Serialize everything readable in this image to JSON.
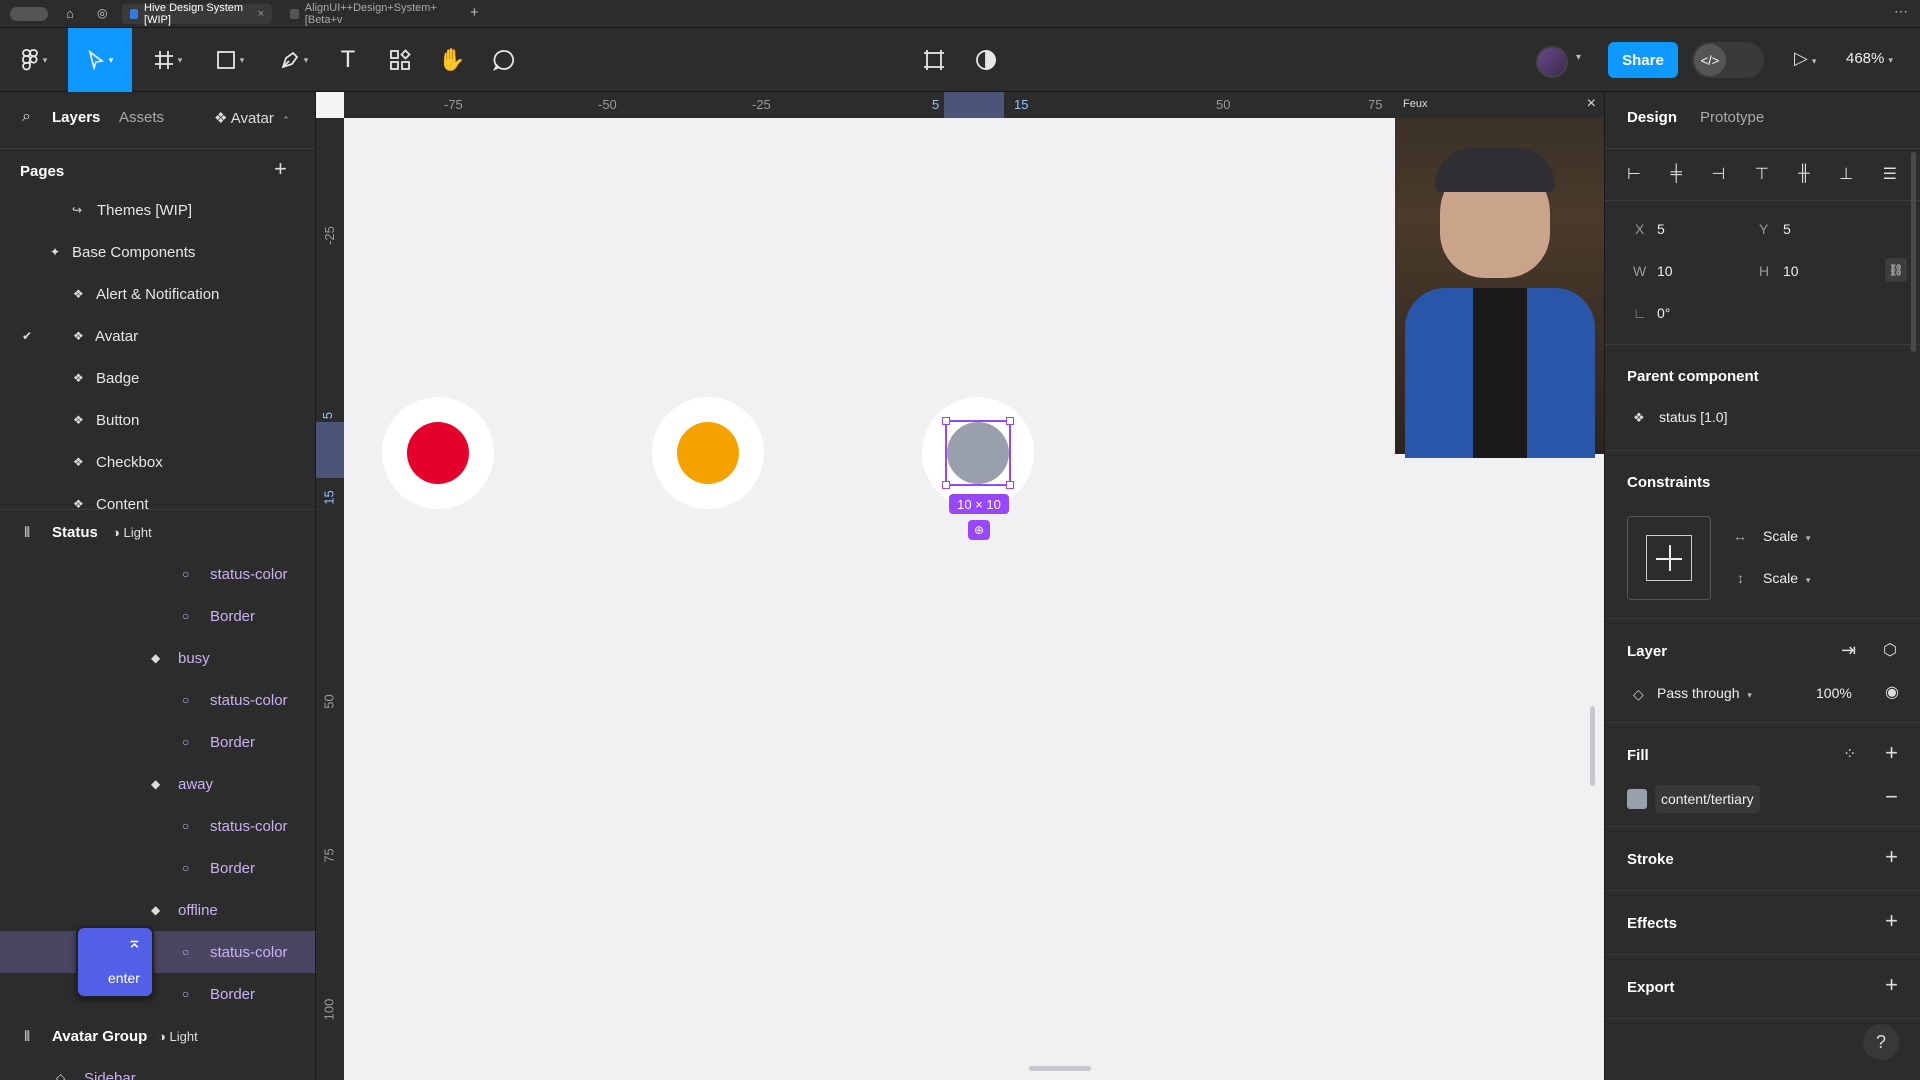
{
  "tabs": [
    {
      "label": "Hive Design System [WIP]",
      "active": true
    },
    {
      "label": "AlignUI++Design+System+[Beta+v",
      "active": false
    }
  ],
  "toolbar": {
    "share_label": "Share",
    "zoom_label": "468%"
  },
  "left_panel": {
    "tab_layers": "Layers",
    "tab_assets": "Assets",
    "current_page": "Avatar",
    "pages_title": "Pages",
    "pages": [
      {
        "label": "Themes [WIP]",
        "icon": "link-arrow-icon"
      },
      {
        "label": "Base Components",
        "icon": "sparkle-icon"
      },
      {
        "label": "Alert & Notification",
        "icon": "component-icon"
      },
      {
        "label": "Avatar",
        "icon": "component-icon",
        "selected": true
      },
      {
        "label": "Badge",
        "icon": "component-icon"
      },
      {
        "label": "Button",
        "icon": "component-icon"
      },
      {
        "label": "Checkbox",
        "icon": "component-icon"
      },
      {
        "label": "Content",
        "icon": "component-icon"
      }
    ],
    "layers_section_title": "Status",
    "layers_section_mode": "Light",
    "layers": [
      {
        "label": "status-color",
        "indent": 2,
        "icon": "ellipse-icon"
      },
      {
        "label": "Border",
        "indent": 2,
        "icon": "ellipse-icon"
      },
      {
        "label": "busy",
        "indent": 1,
        "icon": "variant-icon"
      },
      {
        "label": "status-color",
        "indent": 2,
        "icon": "ellipse-icon"
      },
      {
        "label": "Border",
        "indent": 2,
        "icon": "ellipse-icon"
      },
      {
        "label": "away",
        "indent": 1,
        "icon": "variant-icon"
      },
      {
        "label": "status-color",
        "indent": 2,
        "icon": "ellipse-icon"
      },
      {
        "label": "Border",
        "indent": 2,
        "icon": "ellipse-icon"
      },
      {
        "label": "offline",
        "indent": 1,
        "icon": "variant-icon"
      },
      {
        "label": "status-color",
        "indent": 2,
        "icon": "ellipse-icon",
        "selected": true
      },
      {
        "label": "Border",
        "indent": 2,
        "icon": "ellipse-icon"
      }
    ],
    "group2_title": "Avatar Group",
    "group2_mode": "Light",
    "sidebar_item": "Sidebar",
    "key_hint": "enter"
  },
  "rulers": {
    "top": [
      "-75",
      "-50",
      "-25",
      "5",
      "15",
      "50",
      "75"
    ],
    "left": [
      "-25",
      "5",
      "15",
      "50",
      "75",
      "100"
    ]
  },
  "canvas": {
    "selection_size": "10 × 10",
    "video_label": "Feux",
    "colors": {
      "red": "#e4002b",
      "orange": "#f5a300",
      "grey": "#9aa0ab",
      "selection": "#9747ff"
    }
  },
  "right_panel": {
    "tab_design": "Design",
    "tab_prototype": "Prototype",
    "x_label": "X",
    "x_value": "5",
    "y_label": "Y",
    "y_value": "5",
    "w_label": "W",
    "w_value": "10",
    "h_label": "H",
    "h_value": "10",
    "rotation_value": "0°",
    "parent_title": "Parent component",
    "parent_value": "status [1.0]",
    "constraints_title": "Constraints",
    "constraint_h": "Scale",
    "constraint_v": "Scale",
    "layer_title": "Layer",
    "blend_mode": "Pass through",
    "opacity": "100%",
    "fill_title": "Fill",
    "fill_value": "content/tertiary",
    "stroke_title": "Stroke",
    "effects_title": "Effects",
    "export_title": "Export",
    "help": "?"
  }
}
